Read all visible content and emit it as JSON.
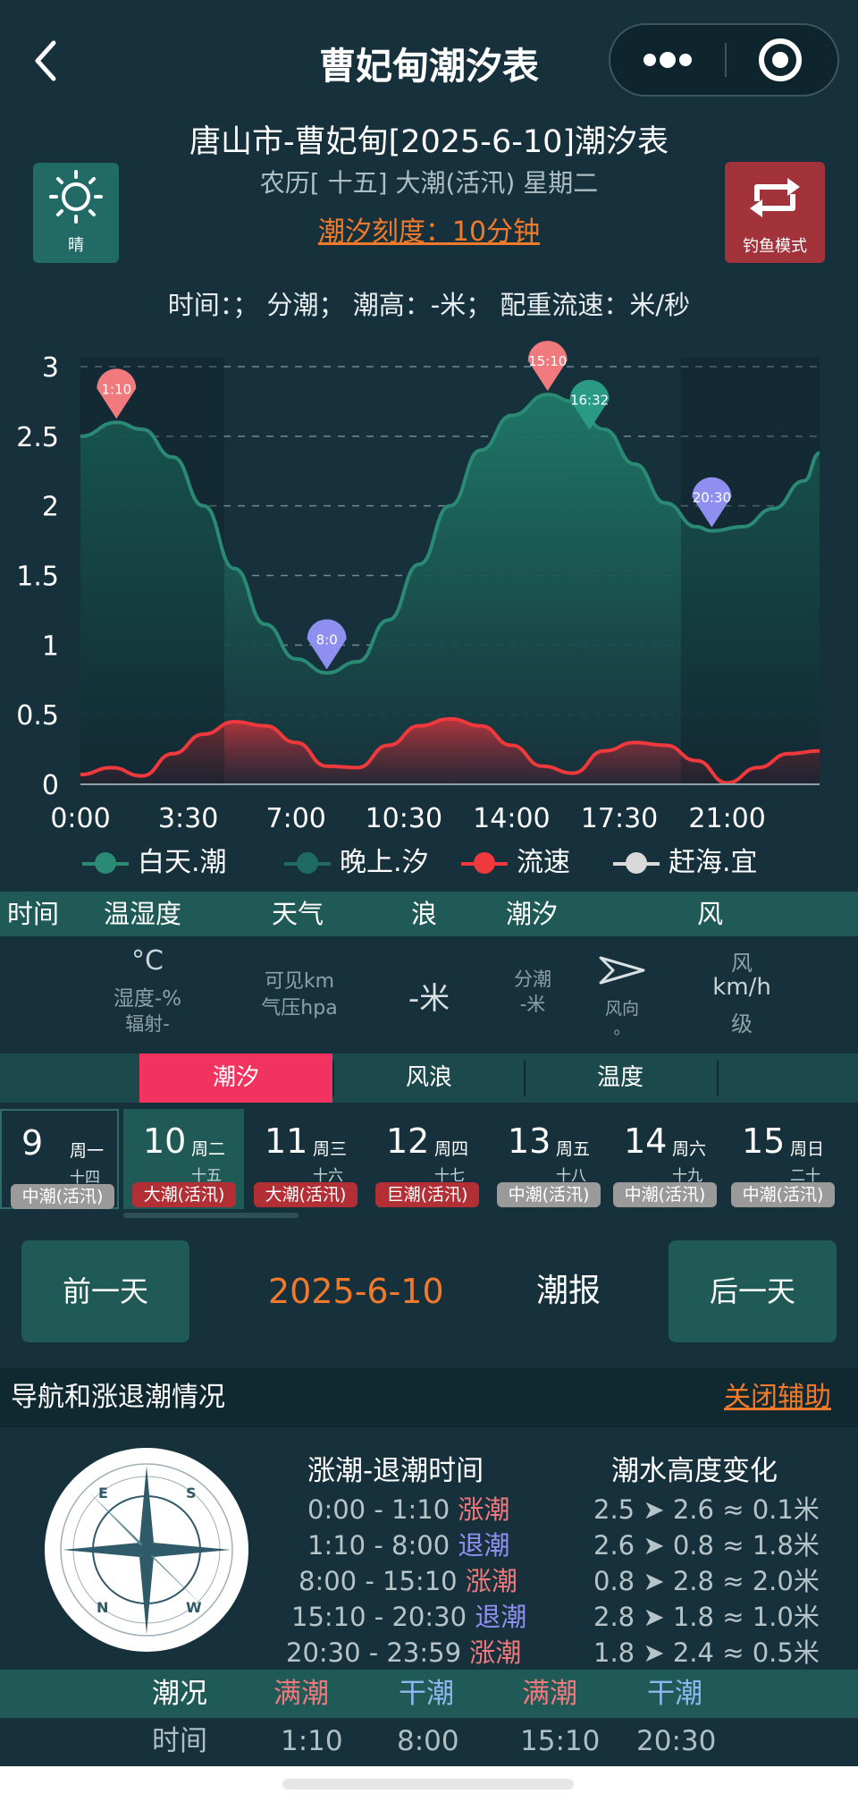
{
  "header": {
    "title": "曹妃甸潮汐表",
    "subtitle": "唐山市-曹妃甸[2025-6-10]潮汐表",
    "lunar": "农历[ 十五] 大潮(活汛) 星期二",
    "scale": "潮汐刻度：10分钟",
    "info_line": "时间：； 分潮； 潮高：-米； 配重流速：米/秒",
    "weather": "晴",
    "fishing_mode": "钓鱼模式"
  },
  "chart_data": {
    "type": "area",
    "x_ticks": [
      "0:00",
      "3:30",
      "7:00",
      "10:30",
      "14:00",
      "17:30",
      "21:00"
    ],
    "y_ticks": [
      "0",
      "0.5",
      "1",
      "1.5",
      "2",
      "2.5",
      "3"
    ],
    "ylim": [
      0,
      3
    ],
    "xlim_hours": [
      0,
      24
    ],
    "series": [
      {
        "name": "白天.潮",
        "color": "#2a8a74",
        "points": [
          [
            0,
            2.5
          ],
          [
            1.17,
            2.6
          ],
          [
            2.0,
            2.55
          ],
          [
            3.0,
            2.35
          ],
          [
            4.0,
            2.0
          ],
          [
            5.0,
            1.55
          ],
          [
            6.0,
            1.15
          ],
          [
            7.0,
            0.9
          ],
          [
            8.0,
            0.8
          ],
          [
            9.0,
            0.88
          ],
          [
            10.0,
            1.18
          ],
          [
            11.0,
            1.58
          ],
          [
            12.0,
            2.0
          ],
          [
            13.0,
            2.4
          ],
          [
            14.0,
            2.65
          ],
          [
            15.17,
            2.8
          ],
          [
            16.0,
            2.75
          ],
          [
            17.0,
            2.55
          ],
          [
            18.0,
            2.3
          ],
          [
            19.0,
            2.02
          ],
          [
            20.0,
            1.85
          ],
          [
            20.5,
            1.82
          ],
          [
            21.5,
            1.85
          ],
          [
            22.5,
            1.98
          ],
          [
            23.5,
            2.18
          ],
          [
            24.0,
            2.38
          ]
        ]
      },
      {
        "name": "流速",
        "color": "#f0393d",
        "points": [
          [
            0,
            0.07
          ],
          [
            1.0,
            0.12
          ],
          [
            2.0,
            0.06
          ],
          [
            3.0,
            0.22
          ],
          [
            4.0,
            0.36
          ],
          [
            5.0,
            0.45
          ],
          [
            6.0,
            0.42
          ],
          [
            7.0,
            0.3
          ],
          [
            8.0,
            0.13
          ],
          [
            9.0,
            0.12
          ],
          [
            10.0,
            0.28
          ],
          [
            11.0,
            0.42
          ],
          [
            12.0,
            0.47
          ],
          [
            13.0,
            0.42
          ],
          [
            14.0,
            0.28
          ],
          [
            15.0,
            0.13
          ],
          [
            16.0,
            0.08
          ],
          [
            17.0,
            0.24
          ],
          [
            18.0,
            0.3
          ],
          [
            19.0,
            0.28
          ],
          [
            20.0,
            0.17
          ],
          [
            21.0,
            0.01
          ],
          [
            22.0,
            0.12
          ],
          [
            23.0,
            0.22
          ],
          [
            24.0,
            0.24
          ]
        ]
      }
    ],
    "markers": [
      {
        "label": "1:10",
        "hour": 1.17,
        "value": 2.6,
        "kind": "high"
      },
      {
        "label": "8:0",
        "hour": 8.0,
        "value": 0.8,
        "kind": "low"
      },
      {
        "label": "15:10",
        "hour": 15.17,
        "value": 2.8,
        "kind": "high"
      },
      {
        "label": "16:32",
        "hour": 16.53,
        "value": 2.52,
        "kind": "mid"
      },
      {
        "label": "20:30",
        "hour": 20.5,
        "value": 1.82,
        "kind": "low"
      }
    ],
    "night_ranges_hours": [
      [
        0,
        4.67
      ],
      [
        19.5,
        24
      ]
    ],
    "legend": [
      "白天.潮",
      "晚上.汐",
      "流速",
      "赶海.宜"
    ],
    "legend_colors": [
      "#2a8a74",
      "#1f6b63",
      "#f0393d",
      "#d9d9d9"
    ],
    "grid": true
  },
  "table": {
    "headers": [
      "时间",
      "温湿度",
      "天气",
      "浪",
      "潮汐",
      "风"
    ],
    "temp": "°C",
    "humidity": "湿度-%",
    "radiation": "辐射-",
    "visibility": "可见km",
    "pressure": "气压hpa",
    "wave": "-米",
    "tide_split": "分潮",
    "tide_height": "-米",
    "wind_dir": "风向",
    "wind_dir_value": "。",
    "wind": "风",
    "wind_speed": "km/h",
    "wind_level": "级"
  },
  "tabs": [
    "潮汐",
    "风浪",
    "温度"
  ],
  "days": [
    {
      "num": "9",
      "week": "周一",
      "lunar": "十四",
      "badge": "中潮(活汛)",
      "badge_color": "#9a9a9a"
    },
    {
      "num": "10",
      "week": "周二",
      "lunar": "十五",
      "badge": "大潮(活汛)",
      "badge_color": "#b22f36"
    },
    {
      "num": "11",
      "week": "周三",
      "lunar": "十六",
      "badge": "大潮(活汛)",
      "badge_color": "#b22f36"
    },
    {
      "num": "12",
      "week": "周四",
      "lunar": "十七",
      "badge": "巨潮(活汛)",
      "badge_color": "#b22f36"
    },
    {
      "num": "13",
      "week": "周五",
      "lunar": "十八",
      "badge": "中潮(活汛)",
      "badge_color": "#9a9a9a"
    },
    {
      "num": "14",
      "week": "周六",
      "lunar": "十九",
      "badge": "中潮(活汛)",
      "badge_color": "#9a9a9a"
    },
    {
      "num": "15",
      "week": "周日",
      "lunar": "二十",
      "badge": "中潮(活汛)",
      "badge_color": "#9a9a9a"
    }
  ],
  "date_nav": {
    "prev": "前一天",
    "date": "2025-6-10",
    "report": "潮报",
    "next": "后一天"
  },
  "section": {
    "title": "导航和涨退潮情况",
    "link": "关闭辅助"
  },
  "tide_times": {
    "heading": "涨潮-退潮时间",
    "rows": [
      {
        "range": "0:00 - 1:10",
        "type": "涨潮",
        "color": "#f0797d"
      },
      {
        "range": "1:10 - 8:00",
        "type": "退潮",
        "color": "#8f8ff0"
      },
      {
        "range": "8:00 - 15:10",
        "type": "涨潮",
        "color": "#f0797d"
      },
      {
        "range": "15:10 - 20:30",
        "type": "退潮",
        "color": "#8f8ff0"
      },
      {
        "range": "20:30 - 23:59",
        "type": "涨潮",
        "color": "#f0797d"
      }
    ]
  },
  "tide_height": {
    "heading": "潮水高度变化",
    "rows": [
      "2.5 ➤ 2.6 ≈ 0.1米",
      "2.6 ➤ 0.8 ≈ 1.8米",
      "0.8 ➤ 2.8 ≈ 2.0米",
      "2.8 ➤ 1.8 ≈ 1.0米",
      "1.8 ➤ 2.4 ≈ 0.5米"
    ]
  },
  "summary": {
    "row1": [
      "潮况",
      "满潮",
      "干潮",
      "满潮",
      "干潮"
    ],
    "row1_colors": [
      "#ffffff",
      "#f0797d",
      "#8fb8f0",
      "#f0797d",
      "#8fb8f0"
    ],
    "row2": [
      "时间",
      "1:10",
      "8:00",
      "15:10",
      "20:30"
    ]
  }
}
